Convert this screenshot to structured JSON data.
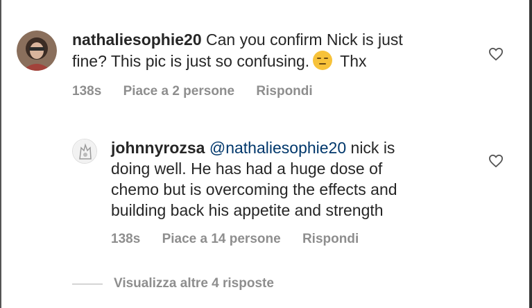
{
  "comments": [
    {
      "username": "nathaliesophie20",
      "text_line1": " Can you confirm Nick is just",
      "text_line2_before_emoji": "fine? This pic is just so confusing.",
      "emoji": "expressionless-face",
      "text_line2_after_emoji": " Thx",
      "time": "138s",
      "likes": "Piace a 2 persone",
      "reply": "Rispondi"
    },
    {
      "username": "johnnyrozsa",
      "mention": "@nathaliesophie20",
      "text_line1_rest": " nick is",
      "text_line2": "doing well. He has had a huge dose of",
      "text_line3": "chemo but is overcoming the effects and",
      "text_line4": "building back his appetite and strength",
      "time": "138s",
      "likes": "Piace a 14 persone",
      "reply": "Rispondi"
    }
  ],
  "view_more": "Visualizza altre 4 risposte",
  "icons": {
    "like": "heart-outline-icon",
    "emoji": "expressionless-face-emoji"
  },
  "colors": {
    "text": "#262626",
    "secondary": "#8e8e8e",
    "mention": "#00376b"
  }
}
